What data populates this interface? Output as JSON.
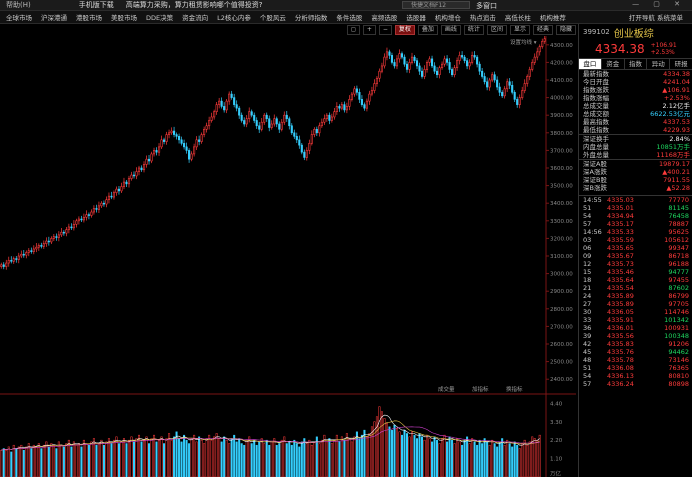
{
  "topbar": {
    "help": "帮助(H)",
    "download": "手机版下载",
    "ad": "高端算力采购，算力租赁影响哪个值得投资?",
    "fast_search": "快捷文档F12",
    "multi": "多窗口",
    "window_buttons": "— ▢ ✕"
  },
  "menu": {
    "items": [
      "全球市场",
      "沪深港通",
      "港股市场",
      "美股市场",
      "DDE决策",
      "资金流向",
      "L2核心内参",
      "个股风云",
      "分析师指数",
      "条件选股",
      "高频选股",
      "选股器",
      "机构增仓",
      "热点追击",
      "高低长柱",
      "机构推荐"
    ],
    "right": "打开导航  系统菜单"
  },
  "toolbar": {
    "items": [
      "◻",
      "+",
      "−",
      "复权",
      "叠加",
      "画线",
      "统计",
      "区间",
      "显示",
      "经典",
      "隐藏"
    ],
    "active": "复权"
  },
  "chart": {
    "settings_label": "设置均线 ▾",
    "price_label": "4337.53",
    "volume_buttons": [
      "成交量",
      "加指标",
      "换指标"
    ],
    "y_price_ticks": [
      "4300.00",
      "4200.00",
      "4100.00",
      "4000.00",
      "3900.00",
      "3800.00",
      "3700.00",
      "3600.00",
      "3500.00",
      "3400.00",
      "3300.00",
      "3200.00",
      "3100.00",
      "3000.00",
      "2900.00",
      "2800.00",
      "2700.00",
      "2600.00",
      "2500.00",
      "2400.00"
    ],
    "y_vol_ticks": [
      "4.40",
      "3.30",
      "2.20",
      "1.10",
      "万亿"
    ],
    "up_color": "#ff3b3b",
    "down_color": "#35d0ff"
  },
  "chart_data": {
    "type": "candlestick",
    "ylim": [
      2350,
      4350
    ],
    "vol_ylim": [
      0,
      4.6
    ],
    "first_open": 3040,
    "closes": [
      3050,
      3040,
      3060,
      3075,
      3070,
      3085,
      3080,
      3100,
      3110,
      3105,
      3120,
      3130,
      3125,
      3140,
      3150,
      3160,
      3155,
      3170,
      3185,
      3180,
      3200,
      3210,
      3205,
      3220,
      3235,
      3230,
      3250,
      3265,
      3260,
      3280,
      3300,
      3310,
      3305,
      3320,
      3335,
      3330,
      3350,
      3370,
      3365,
      3385,
      3400,
      3395,
      3420,
      3440,
      3435,
      3460,
      3480,
      3470,
      3495,
      3520,
      3510,
      3540,
      3560,
      3555,
      3580,
      3600,
      3590,
      3620,
      3650,
      3640,
      3680,
      3700,
      3690,
      3720,
      3760,
      3750,
      3790,
      3800,
      3810,
      3790,
      3780,
      3760,
      3740,
      3720,
      3700,
      3650,
      3680,
      3720,
      3760,
      3750,
      3790,
      3820,
      3840,
      3870,
      3890,
      3920,
      3960,
      3980,
      3950,
      3930,
      3980,
      4020,
      4000,
      3960,
      3940,
      3900,
      3870,
      3850,
      3880,
      3920,
      3900,
      3870,
      3840,
      3820,
      3860,
      3900,
      3880,
      3830,
      3850,
      3880,
      3850,
      3820,
      3860,
      3900,
      3880,
      3840,
      3800,
      3780,
      3760,
      3730,
      3690,
      3660,
      3700,
      3740,
      3790,
      3820,
      3800,
      3840,
      3860,
      3880,
      3900,
      3870,
      3890,
      3920,
      3950,
      3940,
      3960,
      3930,
      3950,
      3990,
      4020,
      4050,
      4030,
      3990,
      3960,
      3940,
      3980,
      4020,
      4040,
      4080,
      4110,
      4150,
      4180,
      4230,
      4260,
      4240,
      4200,
      4180,
      4220,
      4250,
      4230,
      4190,
      4160,
      4200,
      4230,
      4210,
      4180,
      4150,
      4120,
      4160,
      4200,
      4220,
      4180,
      4150,
      4130,
      4170,
      4190,
      4220,
      4200,
      4160,
      4130,
      4170,
      4210,
      4240,
      4230,
      4210,
      4180,
      4200,
      4240,
      4230,
      4190,
      4150,
      4120,
      4090,
      4060,
      4100,
      4130,
      4100,
      4060,
      4030,
      4010,
      4050,
      4090,
      4070,
      4030,
      3990,
      3960,
      4000,
      4040,
      4080,
      4120,
      4160,
      4200,
      4230,
      4260,
      4290,
      4320,
      4334.38
    ],
    "volumes": [
      1.6,
      1.7,
      1.6,
      1.8,
      1.5,
      1.9,
      1.7,
      1.8,
      1.9,
      1.6,
      1.8,
      2.0,
      1.7,
      1.9,
      1.8,
      2.0,
      1.7,
      1.9,
      2.1,
      1.8,
      2.0,
      1.9,
      1.7,
      2.1,
      1.9,
      1.8,
      2.0,
      2.2,
      1.8,
      2.1,
      1.9,
      2.0,
      1.8,
      2.2,
      2.0,
      1.9,
      2.1,
      2.3,
      1.9,
      2.0,
      2.2,
      1.9,
      2.1,
      2.3,
      2.0,
      2.2,
      2.4,
      2.0,
      2.1,
      2.3,
      2.0,
      2.2,
      2.4,
      2.1,
      2.3,
      2.5,
      2.1,
      2.2,
      2.4,
      2.0,
      2.3,
      2.5,
      2.1,
      2.2,
      2.4,
      2.0,
      2.3,
      2.6,
      2.2,
      2.4,
      2.7,
      2.3,
      2.1,
      2.5,
      2.2,
      2.0,
      2.3,
      2.5,
      2.1,
      2.4,
      2.2,
      2.0,
      2.3,
      2.5,
      2.2,
      2.4,
      2.6,
      2.3,
      2.1,
      2.4,
      2.2,
      2.0,
      2.3,
      2.5,
      2.1,
      2.3,
      2.0,
      1.9,
      2.2,
      2.4,
      2.0,
      2.2,
      1.9,
      2.1,
      2.3,
      2.0,
      2.2,
      1.9,
      2.1,
      2.3,
      1.9,
      2.0,
      2.2,
      2.4,
      2.0,
      2.1,
      1.9,
      2.2,
      2.0,
      1.8,
      2.1,
      2.3,
      2.0,
      2.2,
      1.9,
      2.1,
      2.4,
      2.0,
      2.2,
      2.5,
      2.1,
      2.3,
      2.0,
      2.2,
      2.5,
      2.1,
      2.4,
      2.2,
      2.6,
      2.3,
      2.1,
      2.4,
      2.7,
      2.3,
      2.5,
      2.8,
      2.4,
      2.6,
      3.0,
      3.3,
      3.6,
      4.2,
      3.9,
      3.5,
      3.2,
      3.0,
      2.8,
      3.1,
      2.9,
      2.7,
      2.5,
      2.8,
      2.6,
      2.4,
      2.7,
      2.5,
      2.3,
      2.6,
      2.4,
      2.2,
      2.5,
      2.3,
      2.1,
      2.4,
      2.2,
      2.0,
      2.3,
      2.5,
      2.1,
      2.4,
      2.2,
      2.0,
      2.3,
      2.1,
      1.9,
      2.2,
      2.4,
      2.0,
      2.3,
      2.1,
      1.9,
      2.2,
      2.0,
      2.3,
      2.1,
      1.9,
      2.2,
      2.0,
      1.8,
      2.1,
      2.3,
      1.9,
      2.2,
      2.0,
      1.8,
      2.1,
      1.9,
      1.7,
      2.0,
      2.2,
      1.9,
      2.1,
      2.4,
      2.3,
      2.2,
      2.5
    ]
  },
  "quote": {
    "code": "399102",
    "name": "创业板综",
    "price": "4334.38",
    "change": "+106.91",
    "change_pct": "+2.53%",
    "tabs": [
      "盘口",
      "资金",
      "指数",
      "异动",
      "研报"
    ],
    "selected_tab": "盘口",
    "stats": [
      {
        "label": "最新指数",
        "value": "4334.38",
        "color": "red"
      },
      {
        "label": "今日开盘",
        "value": "4241.04",
        "color": "red"
      },
      {
        "label": "指数涨跌",
        "value": "▲106.91",
        "color": "red"
      },
      {
        "label": "指数涨幅",
        "value": "+2.53%",
        "color": "red"
      },
      {
        "label": "总成交量",
        "value": "2.12亿手",
        "color": "white"
      },
      {
        "label": "总成交额",
        "value": "6622.53亿元",
        "color": "cyan"
      },
      {
        "label": "最高指数",
        "value": "4337.53",
        "color": "red"
      },
      {
        "label": "最低指数",
        "value": "4229.93",
        "color": "red"
      }
    ],
    "stats2": [
      {
        "label": "深证换手",
        "value": "2.84%",
        "color": "white"
      },
      {
        "label": "内盘总量",
        "value": "10851万手",
        "color": "green"
      },
      {
        "label": "外盘总量",
        "value": "11168万手",
        "color": "red"
      }
    ],
    "stats3": [
      {
        "label": "深证A股",
        "value": "19879.17",
        "color": "red"
      },
      {
        "label": "深A涨跌",
        "value": "▲400.21",
        "color": "red"
      },
      {
        "label": "深证B股",
        "value": "7911.55",
        "color": "red"
      },
      {
        "label": "深B涨跌",
        "value": "▲52.28",
        "color": "red"
      }
    ],
    "ticks": [
      {
        "t": "14:55",
        "p": "4335.03",
        "v": "77770",
        "c": "red"
      },
      {
        "t": "51",
        "p": "4335.01",
        "v": "81145",
        "c": "green"
      },
      {
        "t": "54",
        "p": "4334.94",
        "v": "76458",
        "c": "green"
      },
      {
        "t": "57",
        "p": "4335.17",
        "v": "78887",
        "c": "red"
      },
      {
        "t": "14:56",
        "p": "4335.33",
        "v": "95625",
        "c": "red"
      },
      {
        "t": "03",
        "p": "4335.59",
        "v": "105612",
        "c": "red"
      },
      {
        "t": "06",
        "p": "4335.65",
        "v": "99347",
        "c": "red"
      },
      {
        "t": "09",
        "p": "4335.67",
        "v": "86718",
        "c": "red"
      },
      {
        "t": "12",
        "p": "4335.73",
        "v": "96188",
        "c": "red"
      },
      {
        "t": "15",
        "p": "4335.46",
        "v": "94777",
        "c": "green"
      },
      {
        "t": "18",
        "p": "4335.64",
        "v": "97455",
        "c": "red"
      },
      {
        "t": "21",
        "p": "4335.54",
        "v": "87602",
        "c": "green"
      },
      {
        "t": "24",
        "p": "4335.89",
        "v": "86799",
        "c": "red"
      },
      {
        "t": "27",
        "p": "4335.89",
        "v": "97705",
        "c": "red"
      },
      {
        "t": "30",
        "p": "4336.05",
        "v": "114746",
        "c": "red"
      },
      {
        "t": "33",
        "p": "4335.91",
        "v": "101342",
        "c": "green"
      },
      {
        "t": "36",
        "p": "4336.01",
        "v": "100931",
        "c": "red"
      },
      {
        "t": "39",
        "p": "4335.56",
        "v": "100348",
        "c": "green"
      },
      {
        "t": "42",
        "p": "4335.83",
        "v": "91206",
        "c": "red"
      },
      {
        "t": "45",
        "p": "4335.76",
        "v": "94462",
        "c": "green"
      },
      {
        "t": "48",
        "p": "4335.78",
        "v": "73146",
        "c": "red"
      },
      {
        "t": "51",
        "p": "4336.08",
        "v": "76365",
        "c": "red"
      },
      {
        "t": "54",
        "p": "4336.13",
        "v": "80810",
        "c": "red"
      },
      {
        "t": "57",
        "p": "4336.24",
        "v": "80898",
        "c": "red"
      }
    ]
  }
}
